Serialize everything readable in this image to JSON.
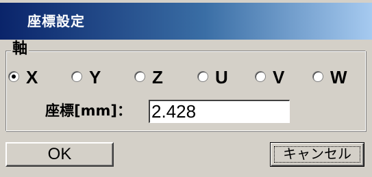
{
  "window": {
    "title": "座標設定"
  },
  "axis_group": {
    "label": "軸",
    "selected": "X",
    "options": [
      {
        "label": "X",
        "checked": true
      },
      {
        "label": "Y",
        "checked": false
      },
      {
        "label": "Z",
        "checked": false
      },
      {
        "label": "U",
        "checked": false
      },
      {
        "label": "V",
        "checked": false
      },
      {
        "label": "W",
        "checked": false
      }
    ]
  },
  "coordinate": {
    "label": "座標[mm]：",
    "value": "2.428"
  },
  "buttons": {
    "ok_label": "OK",
    "cancel_label": "キャンセル"
  }
}
